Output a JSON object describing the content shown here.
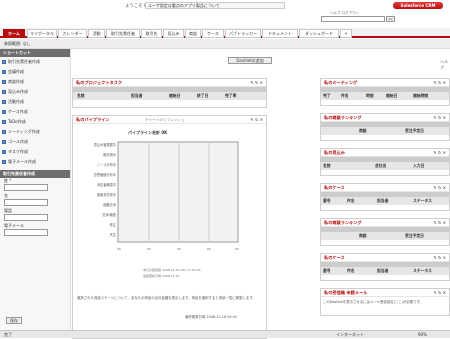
{
  "header": {
    "welcome": "ようこそ hoge",
    "notice": "ユーザ設定は重点のアプリ製品について",
    "brand": "Salesforce CRM",
    "search_placeholder": "",
    "search_btn": "Go",
    "top_links": "ヘルプ  ログアウト"
  },
  "tabs": [
    {
      "label": "ホーム",
      "active": true
    },
    {
      "label": "マイポータル"
    },
    {
      "label": "カレンダー"
    },
    {
      "label": "活動"
    },
    {
      "label": "取引先責任者"
    },
    {
      "label": "取引先"
    },
    {
      "label": "見込み"
    },
    {
      "label": "商談"
    },
    {
      "label": "ケース"
    },
    {
      "label": "パブトラッカー"
    },
    {
      "label": "ドキュメント"
    },
    {
      "label": "ダッシュボード"
    },
    {
      "label": "+"
    }
  ],
  "breadcrumb": "参照範囲: なし",
  "sidebar": {
    "shortcut_title": "ショートカット",
    "items": [
      "取引先責任者作成",
      "会議作成",
      "商談作成",
      "見込み作成",
      "活動作成",
      "ケース作成",
      "ToDo作成",
      "ミーティング作成",
      "ゴール作成",
      "タスク作成",
      "電子メール作成"
    ],
    "form_title": "取引先責任者作成",
    "fields": [
      "姓 *",
      "名",
      "電話",
      "電子メール"
    ],
    "save_label": "保存"
  },
  "main": {
    "add_dashlet": "Dashletの追加",
    "help": "ヘルプ",
    "left": {
      "projects": {
        "title": "私のプロジェクトタスク",
        "cols": [
          "名前",
          "担当者",
          "開始日",
          "終了日",
          "完了率",
          "アクティブ"
        ]
      },
      "pipeline": {
        "title": "私のパイプライン",
        "subtitle": "チャートのリフレッシュ",
        "chart_title": "パイプライン合計 0K",
        "categories": [
          "見込み客発掘中",
          "概況済み",
          "ニーズ分析中",
          "意思価値分析中",
          "決定者確認中",
          "提案書作成中",
          "価格交渉",
          "交渉/審査",
          "受注",
          "失注"
        ],
        "note": "本日の経過値 2008-12-16 (Mi) 01:02:09",
        "note2": "最終更新日時 2008-12-16",
        "desc": "選択された商談ステージについて、あなたの商談の合計金額を表示します。商談を選択すると商談一覧に移動します。",
        "updated": "最終更新日時 2008-12-16 00:45"
      }
    },
    "right": [
      {
        "title": "私のミーティング",
        "cols": [
          "完了",
          "件名",
          "時間",
          "開始日",
          "開始時間"
        ]
      },
      {
        "title": "私の商談ランキング",
        "cols": [
          "",
          "商談",
          "受注予定日"
        ]
      },
      {
        "title": "私の見込み",
        "cols": [
          "名前",
          "会社名",
          "入力日"
        ]
      },
      {
        "title": "私のケース",
        "cols": [
          "番号",
          "件名",
          "担当者",
          "ステータス"
        ]
      },
      {
        "title": "私の商談ランキング",
        "cols": [
          "",
          "商談",
          "受注予定日"
        ]
      },
      {
        "title": "私のケース",
        "cols": [
          "番号",
          "件名",
          "担当者",
          "ステータス"
        ]
      },
      {
        "title": "私の受信箱 未読メール",
        "desc": "このDashletを表示させるにはメール受信設定(ここ)が必要です。"
      }
    ]
  },
  "status": {
    "left": "完了",
    "internet": "インターネット",
    "zoom": "90%"
  }
}
